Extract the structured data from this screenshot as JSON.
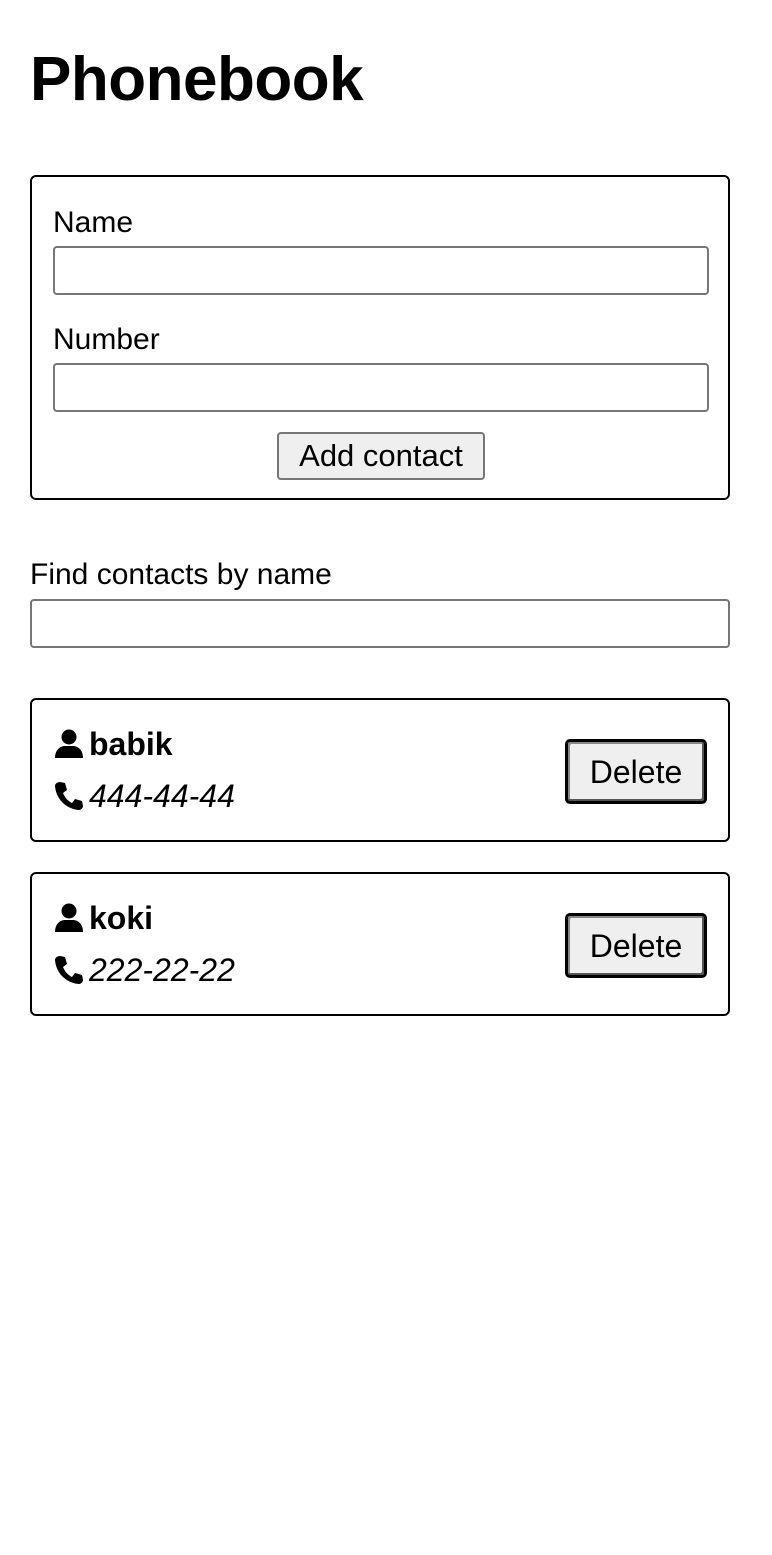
{
  "page": {
    "title": "Phonebook"
  },
  "form": {
    "name_label": "Name",
    "name_value": "",
    "number_label": "Number",
    "number_value": "",
    "add_button_label": "Add contact"
  },
  "filter": {
    "label": "Find contacts by name",
    "value": ""
  },
  "contacts": [
    {
      "name": "babik",
      "number": "444-44-44",
      "delete_label": "Delete"
    },
    {
      "name": "koki",
      "number": "222-22-22",
      "delete_label": "Delete"
    }
  ],
  "icons": {
    "person": "user-icon",
    "phone": "phone-icon"
  },
  "colors": {
    "text": "#000000",
    "border": "#000000",
    "input_border": "#767676",
    "button_bg": "#efefef"
  }
}
